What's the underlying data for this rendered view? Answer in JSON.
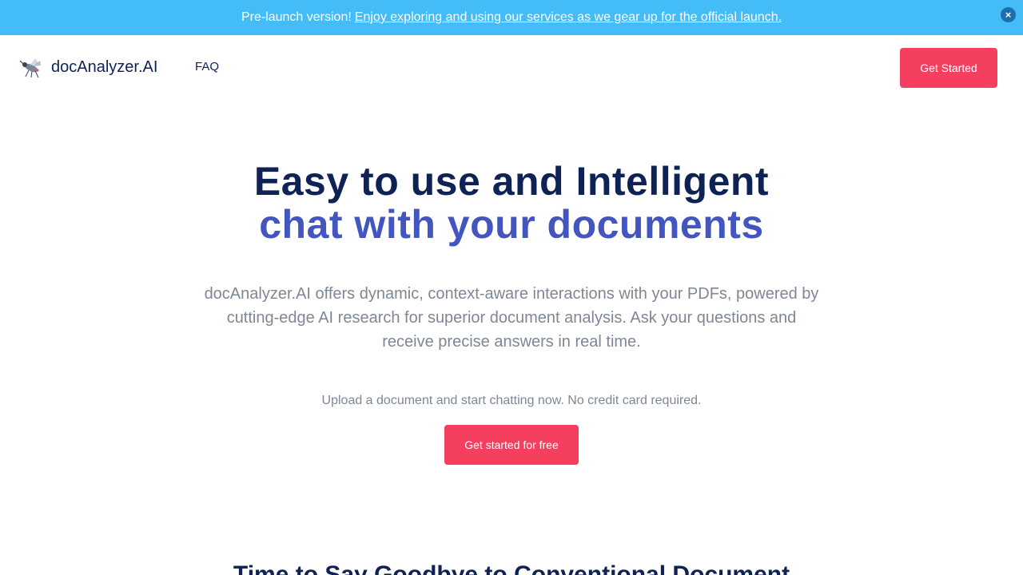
{
  "banner": {
    "prefix": "Pre-launch version!",
    "link_text": "Enjoy exploring and using our services as we gear up for the official launch.",
    "close_label": "×"
  },
  "nav": {
    "brand_name": "docAnalyzer.AI",
    "brand_icon": "robot-mosquito-logo",
    "faq_label": "FAQ",
    "cta_label": "Get Started"
  },
  "hero": {
    "title_line1": "Easy to use and Intelligent",
    "title_line2": "chat with your documents",
    "description": "docAnalyzer.AI offers dynamic, context-aware interactions with your PDFs, powered by cutting-edge AI research for superior document analysis. Ask your questions and receive precise answers in real time.",
    "note": "Upload a document and start chatting now. No credit card required.",
    "cta_label": "Get started for free"
  },
  "next_section": {
    "heading": "Time to Say Goodbye to Conventional Document"
  },
  "colors": {
    "banner": "#44bcf7",
    "brand_navy": "#0f2255",
    "accent_blue": "#4355be",
    "cta": "#f43f5e",
    "muted": "#7d8796"
  }
}
